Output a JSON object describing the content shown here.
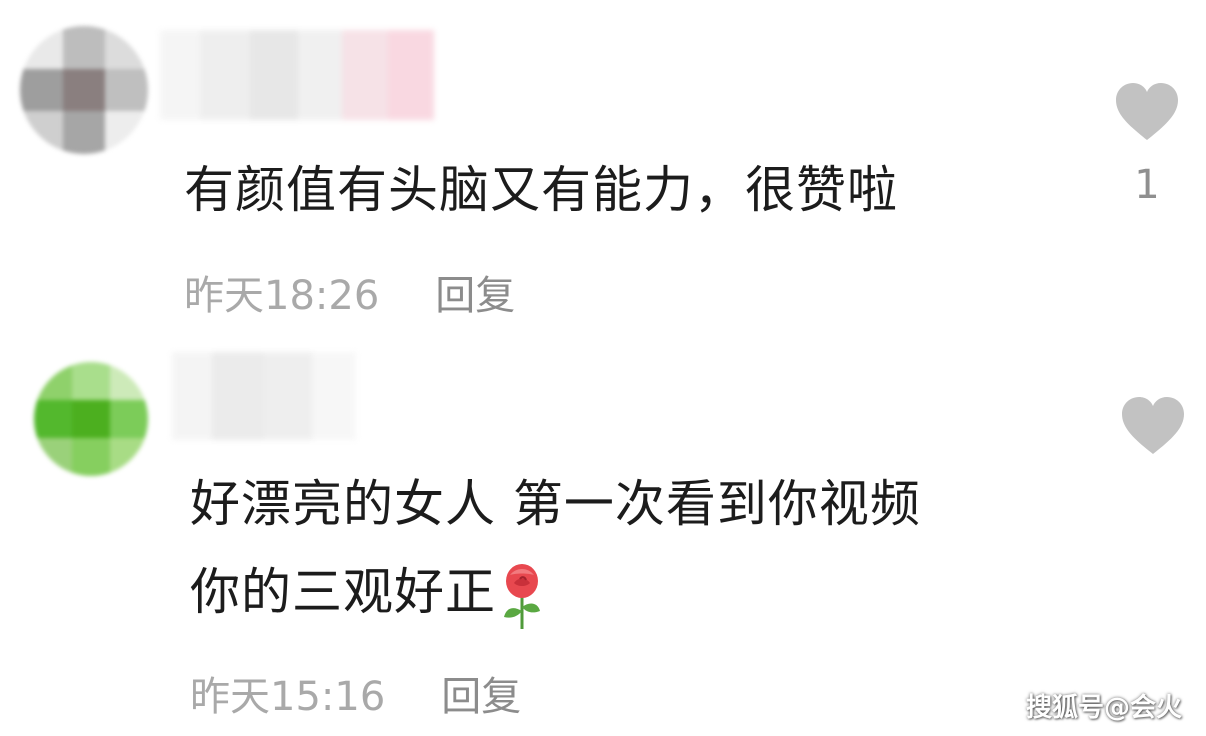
{
  "comments": [
    {
      "text_lines": [
        "有颜值有头脑又有能力，很赞啦"
      ],
      "time": "昨天18:26",
      "reply_label": "回复",
      "like_count": "1",
      "avatar_colors": [
        "#e9e9e9",
        "#bdbdbd",
        "#dcdcdc",
        "#9e9e9e",
        "#8a7f7f",
        "#bfbfbf",
        "#cfcfcf",
        "#a6a6a6",
        "#ededed"
      ],
      "username_colors": [
        "#f4f4f4",
        "#ececec",
        "#e3e3e3",
        "#eeeeee",
        "#f5dde3",
        "#f8d2dc"
      ]
    },
    {
      "text_lines": [
        "好漂亮的女人 第一次看到你视频",
        "你的三观好正"
      ],
      "time": "昨天15:16",
      "reply_label": "回复",
      "like_count": "",
      "avatar_colors": [
        "#8fd16b",
        "#a9de8c",
        "#cdeab9",
        "#53b82d",
        "#4caf1f",
        "#7ccc59",
        "#9ad17a",
        "#86cf5f",
        "#a8dc85"
      ],
      "username_colors": [
        "#f3f3f3",
        "#e8e8e8",
        "#ececec",
        "#f6f6f6"
      ]
    }
  ],
  "icons": {
    "like": "heart-icon",
    "emoji": "rose-emoji-icon"
  },
  "colors": {
    "heart": "#c2c2c2",
    "meta_text": "#a9a9a9"
  },
  "watermark": "搜狐号@会火"
}
